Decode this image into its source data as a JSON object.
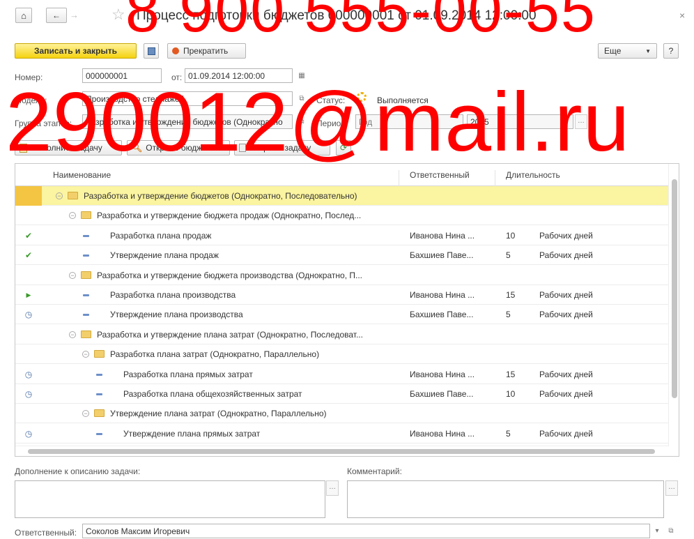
{
  "title": "Процесс подготовки бюджетов 000000001 от 01.09.2014 12:00:00",
  "toolbar": {
    "save_close": "Записать и закрыть",
    "stop": "Прекратить",
    "more": "Еще",
    "help": "?"
  },
  "form": {
    "number_label": "Номер:",
    "number_value": "000000001",
    "date_label": "от:",
    "date_value": "01.09.2014 12:00:00",
    "model_label": "Модель:",
    "model_value": "Производство стеллажей",
    "status_label": "Статус:",
    "status_value": "Выполняется",
    "group_label": "Группа этапов:",
    "group_value": "Разработка и утверждение бюджетов (Однократно",
    "period_label": "Период:",
    "period_value": "Год",
    "year_value": "2015"
  },
  "actions": {
    "execute": "Выполнить задачу",
    "open_budget": "Открыть бюджет",
    "open_task": "Открыть задачу"
  },
  "grid": {
    "columns": [
      "Наименование",
      "Ответственный",
      "Длительность"
    ],
    "rows": [
      {
        "status": "none",
        "kind": "folder",
        "level": 0,
        "name": "Разработка и утверждение бюджетов (Однократно, Последовательно)",
        "resp": "",
        "dur": "",
        "unit": "",
        "selected": true
      },
      {
        "status": "none",
        "kind": "folder",
        "level": 1,
        "name": "Разработка и утверждение бюджета продаж (Однократно, Послед...",
        "resp": "",
        "dur": "",
        "unit": ""
      },
      {
        "status": "done",
        "kind": "task",
        "level": 2,
        "name": "Разработка плана продаж",
        "resp": "Иванова Нина ...",
        "dur": "10",
        "unit": "Рабочих дней"
      },
      {
        "status": "done",
        "kind": "task",
        "level": 2,
        "name": "Утверждение плана продаж",
        "resp": "Бахшиев Паве...",
        "dur": "5",
        "unit": "Рабочих дней"
      },
      {
        "status": "none",
        "kind": "folder",
        "level": 1,
        "name": "Разработка и утверждение бюджета производства (Однократно, П...",
        "resp": "",
        "dur": "",
        "unit": ""
      },
      {
        "status": "running",
        "kind": "task",
        "level": 2,
        "name": "Разработка плана производства",
        "resp": "Иванова Нина ...",
        "dur": "15",
        "unit": "Рабочих дней"
      },
      {
        "status": "waiting",
        "kind": "task",
        "level": 2,
        "name": "Утверждение плана производства",
        "resp": "Бахшиев Паве...",
        "dur": "5",
        "unit": "Рабочих дней"
      },
      {
        "status": "none",
        "kind": "folder",
        "level": 1,
        "name": "Разработка и утверждение плана затрат (Однократно, Последоват...",
        "resp": "",
        "dur": "",
        "unit": ""
      },
      {
        "status": "none",
        "kind": "folder",
        "level": 2,
        "name": "Разработка плана затрат (Однократно, Параллельно)",
        "resp": "",
        "dur": "",
        "unit": ""
      },
      {
        "status": "waiting",
        "kind": "task",
        "level": 3,
        "name": "Разработка плана прямых затрат",
        "resp": "Иванова Нина ...",
        "dur": "15",
        "unit": "Рабочих дней"
      },
      {
        "status": "waiting",
        "kind": "task",
        "level": 3,
        "name": "Разработка плана общехозяйственных затрат",
        "resp": "Бахшиев Паве...",
        "dur": "10",
        "unit": "Рабочих дней"
      },
      {
        "status": "none",
        "kind": "folder",
        "level": 2,
        "name": "Утверждение плана затрат (Однократно, Параллельно)",
        "resp": "",
        "dur": "",
        "unit": ""
      },
      {
        "status": "waiting",
        "kind": "task",
        "level": 3,
        "name": "Утверждение плана прямых затрат",
        "resp": "Иванова Нина ...",
        "dur": "5",
        "unit": "Рабочих дней"
      }
    ]
  },
  "bottom": {
    "addition_label": "Дополнение к описанию задачи:",
    "comment_label": "Комментарий:",
    "responsible_label": "Ответственный:",
    "responsible_value": "Соколов Максим Игоревич"
  },
  "watermark": {
    "line1": "8 900 555-00-55",
    "line2": "290012@mail.ru"
  },
  "colors": {
    "accent_yellow": "#f5d20f",
    "selected_row": "#fbf4a0",
    "watermark": "#ff0000",
    "check_green": "#3a9a2a"
  }
}
